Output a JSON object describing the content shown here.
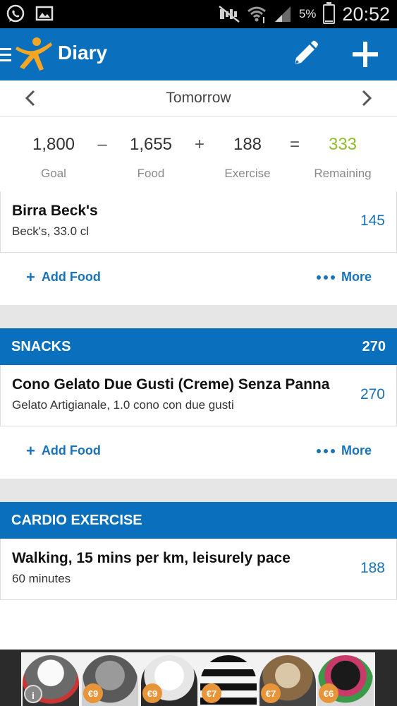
{
  "status_bar": {
    "battery": "5%",
    "time": "20:52",
    "icons": [
      "whatsapp-icon",
      "gallery-icon",
      "mute-icon",
      "wifi-icon",
      "signal-icon",
      "battery-icon"
    ]
  },
  "app_bar": {
    "title": "Diary",
    "icons": [
      "menu-icon",
      "app-logo-icon",
      "edit-icon",
      "add-icon"
    ]
  },
  "date_nav": {
    "label": "Tomorrow"
  },
  "summary": {
    "goal": "1,800",
    "goal_label": "Goal",
    "minus": "–",
    "food": "1,655",
    "food_label": "Food",
    "plus": "+",
    "exercise": "188",
    "exercise_label": "Exercise",
    "equals": "=",
    "remaining": "333",
    "remaining_label": "Remaining",
    "remaining_color": "#8fbe2c"
  },
  "previous_meal": {
    "items": [
      {
        "name": "Birra Beck's",
        "desc": "Beck's, 33.0 cl",
        "calories": "145"
      }
    ],
    "add_food": "Add Food",
    "more": "More"
  },
  "snacks": {
    "title": "SNACKS",
    "total": "270",
    "items": [
      {
        "name": "Cono Gelato Due Gusti (Creme) Senza Panna",
        "desc": "Gelato Artigianale, 1.0 cono con due gusti",
        "calories": "270"
      }
    ],
    "add_food": "Add Food",
    "more": "More"
  },
  "cardio": {
    "title": "CARDIO EXERCISE",
    "items": [
      {
        "name": "Walking, 15 mins per km, leisurely pace",
        "desc": "60 minutes",
        "calories": "188"
      }
    ]
  },
  "ad": {
    "prices": [
      "€9",
      "€9",
      "€7",
      "€7",
      "€6"
    ]
  },
  "colors": {
    "brand_blue": "#0a70be",
    "link_blue": "#1a73b8",
    "gap_gray": "#e6e6e6"
  }
}
